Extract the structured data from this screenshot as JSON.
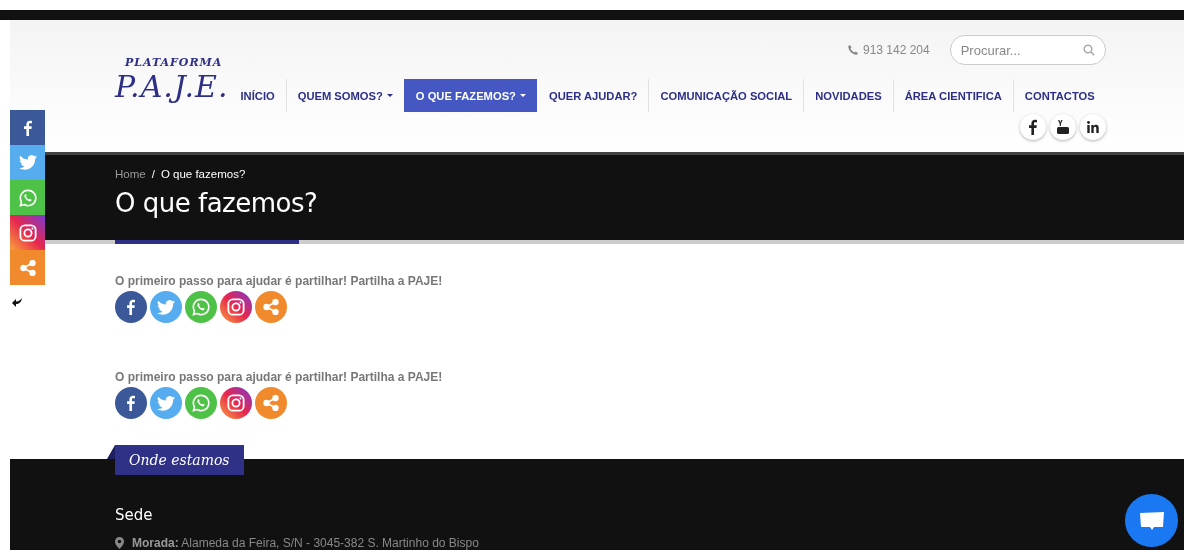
{
  "header": {
    "logo": {
      "top": "PLATAFORMA",
      "main": "P.A.J.E."
    },
    "phone": "913 142 204",
    "search": {
      "placeholder": "Procurar..."
    },
    "nav": [
      {
        "label": "INÍCIO",
        "dropdown": false,
        "selected": false
      },
      {
        "label": "QUEM SOMOS?",
        "dropdown": true,
        "selected": false
      },
      {
        "label": "O QUE FAZEMOS?",
        "dropdown": true,
        "selected": true
      },
      {
        "label": "QUER AJUDAR?",
        "dropdown": false,
        "selected": false
      },
      {
        "label": "COMUNICAÇÃO SOCIAL",
        "dropdown": false,
        "selected": false
      },
      {
        "label": "NOVIDADES",
        "dropdown": false,
        "selected": false
      },
      {
        "label": "ÁREA CIENTIFICA",
        "dropdown": false,
        "selected": false
      },
      {
        "label": "CONTACTOS",
        "dropdown": false,
        "selected": false
      }
    ],
    "social": [
      {
        "kind": "facebook"
      },
      {
        "kind": "youtube"
      },
      {
        "kind": "linkedin"
      }
    ]
  },
  "side_share": [
    {
      "kind": "facebook"
    },
    {
      "kind": "twitter"
    },
    {
      "kind": "whatsapp"
    },
    {
      "kind": "instagram"
    },
    {
      "kind": "share"
    }
  ],
  "banner": {
    "breadcrumb": {
      "items": [
        "Home",
        "O que fazemos?"
      ],
      "separator": "/"
    },
    "title": "O que fazemos?"
  },
  "share_blocks": [
    {
      "text": "O primeiro passo para ajudar é partilhar! Partilha a PAJE!",
      "buttons": [
        {
          "kind": "facebook"
        },
        {
          "kind": "twitter"
        },
        {
          "kind": "whatsapp"
        },
        {
          "kind": "instagram"
        },
        {
          "kind": "share"
        }
      ]
    },
    {
      "text": "O primeiro passo para ajudar é partilhar! Partilha a PAJE!",
      "buttons": [
        {
          "kind": "facebook"
        },
        {
          "kind": "twitter"
        },
        {
          "kind": "whatsapp"
        },
        {
          "kind": "instagram"
        },
        {
          "kind": "share"
        }
      ]
    }
  ],
  "footer": {
    "tab": "Onde estamos",
    "heading": "Sede",
    "address": {
      "label": "Morada:",
      "value": "Alameda da Feira, S/N - 3045-382 S. Martinho do Bispo"
    }
  }
}
